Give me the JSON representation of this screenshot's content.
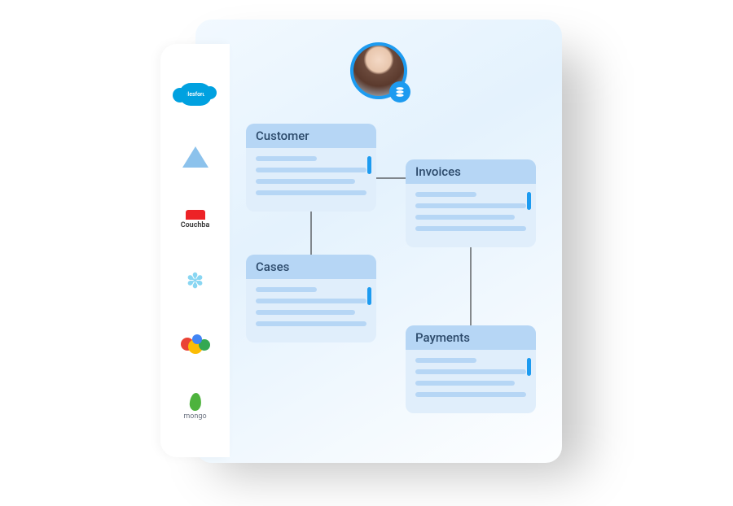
{
  "avatar": {
    "badge_icon": "database-stack-icon"
  },
  "sidebar": {
    "integrations": [
      {
        "name": "salesforce",
        "label": "salesforce"
      },
      {
        "name": "azure",
        "label": ""
      },
      {
        "name": "couchbase",
        "label": "Couchba"
      },
      {
        "name": "snowflake",
        "label": ""
      },
      {
        "name": "google-cloud",
        "label": ""
      },
      {
        "name": "mongodb",
        "label": "mongo"
      }
    ]
  },
  "entities": {
    "customer": {
      "title": "Customer"
    },
    "invoices": {
      "title": "Invoices"
    },
    "cases": {
      "title": "Cases"
    },
    "payments": {
      "title": "Payments"
    }
  },
  "connections": [
    {
      "from": "customer",
      "to": "invoices"
    },
    {
      "from": "customer",
      "to": "cases"
    },
    {
      "from": "invoices",
      "to": "payments"
    }
  ],
  "colors": {
    "accent": "#1d9bf0",
    "card_header": "#b6d6f5",
    "card_body": "#e0eefb",
    "text": "#2c4a6b"
  }
}
